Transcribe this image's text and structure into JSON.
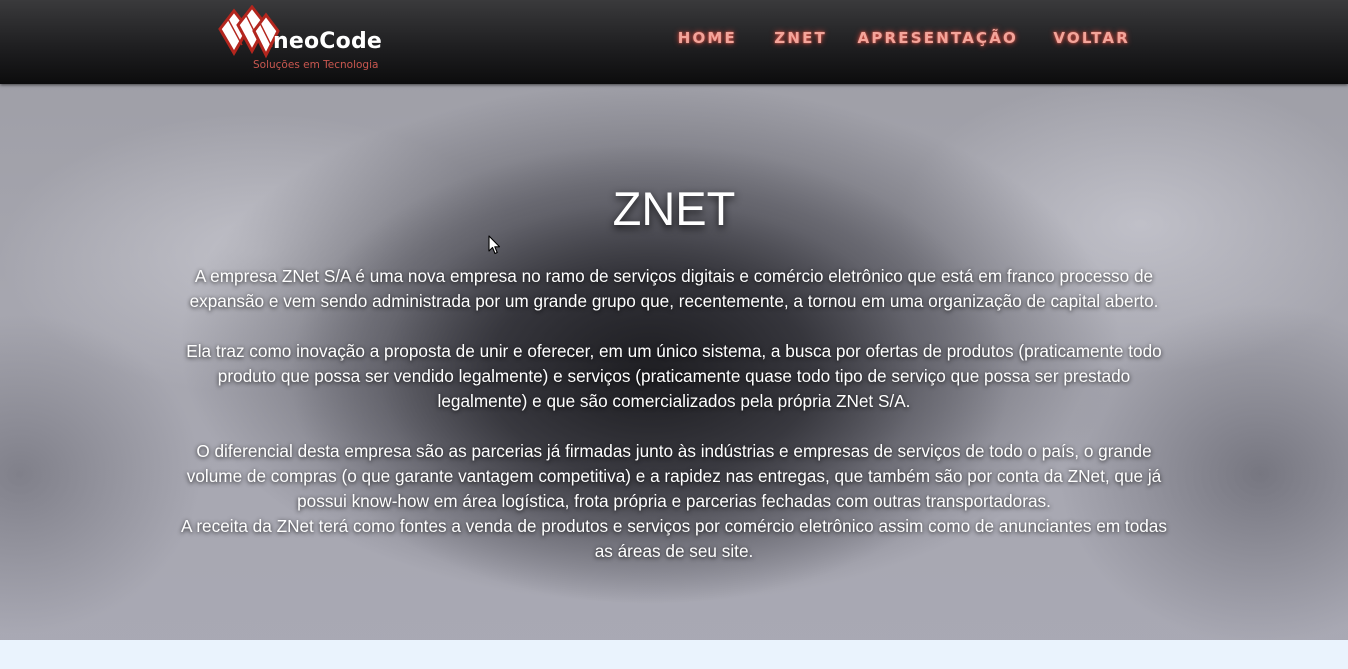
{
  "brand": {
    "name": "neoCode",
    "tagline": "Soluções em Tecnologia",
    "accent_color": "#c9574f"
  },
  "nav": {
    "items": [
      {
        "label": "HOME"
      },
      {
        "label": "ZNET"
      },
      {
        "label": "APRESENTAÇÃO"
      },
      {
        "label": "VOLTAR"
      }
    ],
    "link_color": "#f3a49a"
  },
  "hero": {
    "title": "ZNET",
    "paragraphs": [
      "A empresa ZNet S/A é uma nova empresa no ramo de serviços digitais e comércio eletrônico que está em franco processo de expansão e vem sendo administrada por um grande grupo que, recentemente, a tornou em uma organização de capital aberto.",
      "Ela traz como inovação a proposta de unir e oferecer, em um único sistema, a busca por ofertas de produtos (praticamente todo produto que possa ser vendido legalmente) e serviços (praticamente quase todo tipo de serviço que possa ser prestado legalmente) e que são comercializados pela própria ZNet S/A.",
      "O diferencial desta empresa são as parcerias já firmadas junto às indústrias e empresas de serviços de todo o país, o grande volume de compras (o que garante vantagem competitiva) e a rapidez nas entregas, que também são por conta da ZNet, que já possui know-how em área logística, frota própria e parcerias fechadas com outras transportadoras.",
      "A receita da ZNet terá como fontes a venda de produtos e serviços por comércio eletrônico assim como de anunciantes em todas as áreas de seu site."
    ]
  },
  "icons": {
    "logo": "diamond-logo-icon",
    "cursor": "mouse-pointer-icon"
  }
}
